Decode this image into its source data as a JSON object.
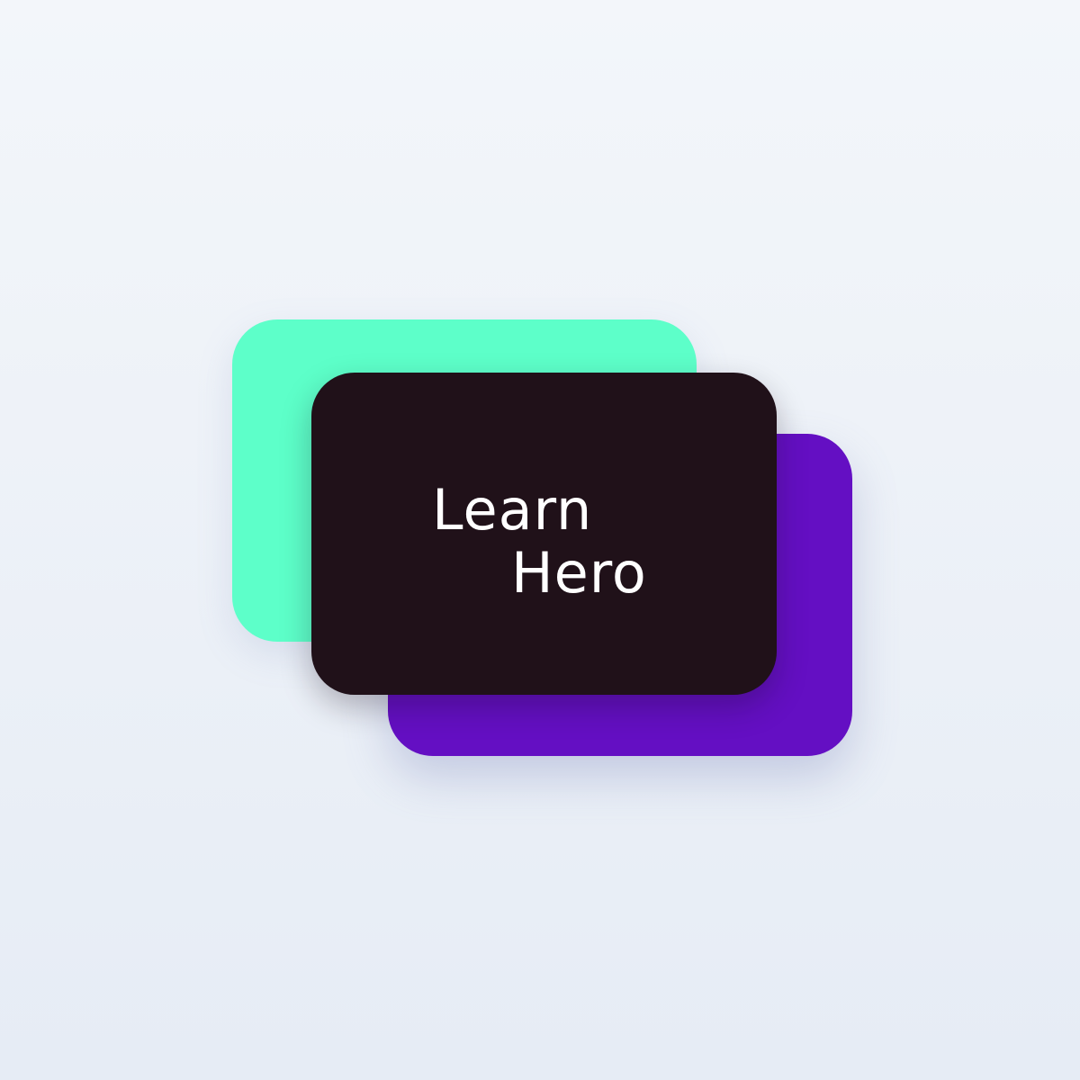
{
  "logo": {
    "wordmark_line_1": "Learn",
    "wordmark_line_2": "Hero"
  },
  "colors": {
    "green": "#5dffc9",
    "dark": "#201119",
    "purple": "#640fc3",
    "text": "#ffffff"
  }
}
